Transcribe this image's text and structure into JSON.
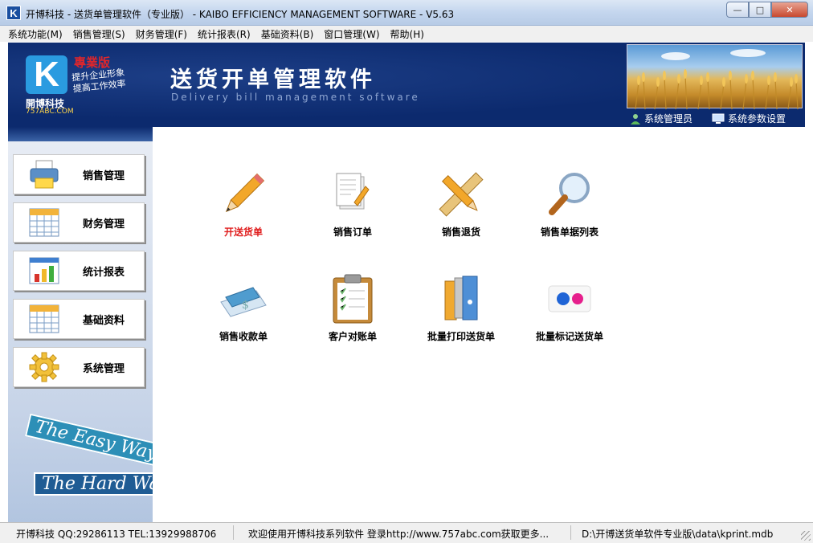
{
  "window": {
    "title": "开博科技 - 送货单管理软件（专业版） - KAIBO EFFICIENCY MANAGEMENT SOFTWARE - V5.63",
    "app_icon_letter": "K",
    "controls": {
      "minimize": "—",
      "maximize": "□",
      "close": "✕"
    }
  },
  "menu": [
    "系统功能(M)",
    "销售管理(S)",
    "财务管理(F)",
    "统计报表(R)",
    "基础资料(B)",
    "窗口管理(W)",
    "帮助(H)"
  ],
  "banner": {
    "logo_letter": "K",
    "edition": "專業版",
    "slogan_line1": "提升企业形象",
    "slogan_line2": "提高工作效率",
    "company": "開博科技",
    "url": "757ABC.COM",
    "title": "送货开单管理软件",
    "subtitle": "Delivery bill management software",
    "actions": [
      {
        "label": "系统管理员",
        "icon": "user-icon"
      },
      {
        "label": "系统参数设置",
        "icon": "monitor-settings-icon"
      }
    ]
  },
  "sidebar": {
    "items": [
      {
        "label": "销售管理",
        "icon": "printer-icon"
      },
      {
        "label": "财务管理",
        "icon": "spreadsheet-icon"
      },
      {
        "label": "统计报表",
        "icon": "bar-chart-icon"
      },
      {
        "label": "基础资料",
        "icon": "spreadsheet-icon"
      },
      {
        "label": "系统管理",
        "icon": "gear-icon"
      }
    ],
    "sign_easy": "The Easy Way",
    "sign_hard": "The Hard Way"
  },
  "functions": [
    {
      "label": "开送货单",
      "icon": "pencil-icon",
      "active": true
    },
    {
      "label": "销售订单",
      "icon": "document-edit-icon",
      "active": false
    },
    {
      "label": "销售退货",
      "icon": "ruler-pencil-icon",
      "active": false
    },
    {
      "label": "销售单据列表",
      "icon": "magnifier-icon",
      "active": false
    },
    {
      "label": "销售收款单",
      "icon": "payment-check-icon",
      "active": false
    },
    {
      "label": "客户对账单",
      "icon": "clipboard-icon",
      "active": false
    },
    {
      "label": "批量打印送货单",
      "icon": "binders-icon",
      "active": false
    },
    {
      "label": "批量标记送货单",
      "icon": "color-dots-icon",
      "active": false
    }
  ],
  "status": {
    "company": "开博科技 QQ:29286113 TEL:13929988706",
    "welcome": "欢迎使用开博科技系列软件   登录http://www.757abc.com获取更多...",
    "db_path": "D:\\开博送货单软件专业版\\data\\kprint.mdb"
  },
  "colors": {
    "banner_bg": "#0c2a6e",
    "active_label": "#e01c1c",
    "sidebar_bg": "#c7d4e8"
  }
}
